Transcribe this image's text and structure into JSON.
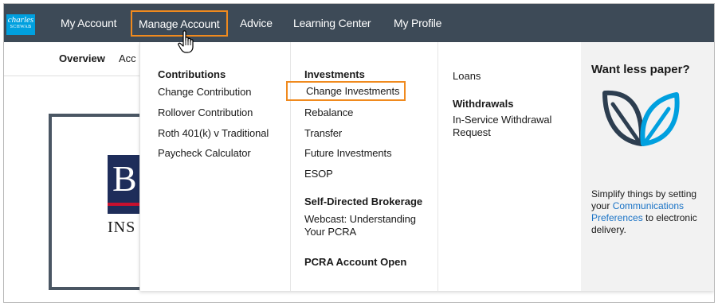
{
  "logo": {
    "line1": "charles",
    "line2": "SCHWAB"
  },
  "topnav": {
    "items": [
      "My Account",
      "Manage Account",
      "Advice",
      "Learning Center",
      "My Profile"
    ]
  },
  "subnav": {
    "overview": "Overview",
    "partial": "Acc"
  },
  "card": {
    "logo_letters": "B",
    "text": "INS"
  },
  "dropdown": {
    "col1": {
      "header": "Contributions",
      "links": [
        "Change Contribution",
        "Rollover Contribution",
        "Roth 401(k) v Traditional",
        "Paycheck Calculator"
      ]
    },
    "col2": {
      "header": "Investments",
      "links": [
        "Change Investments",
        "Rebalance",
        "Transfer",
        "Future Investments",
        "ESOP"
      ],
      "header2": "Self-Directed Brokerage",
      "links2": [
        "Webcast: Understanding Your PCRA"
      ],
      "header3": "PCRA Account Open"
    },
    "col3": {
      "header": "Loans",
      "header2": "Withdrawals",
      "links": [
        "In-Service Withdrawal Request"
      ]
    },
    "promo": {
      "title": "Want less paper?",
      "text_before": "Simplify things by setting your ",
      "link": "Communications Preferences",
      "text_after": " to electronic delivery."
    }
  },
  "colors": {
    "nav_bg": "#3d4a57",
    "highlight": "#f08a1e",
    "link_blue": "#1a73c6",
    "leaf_dark": "#2d3e50",
    "leaf_blue": "#00a0df"
  },
  "icons": [
    "leaf-icon",
    "hand-cursor-icon"
  ]
}
